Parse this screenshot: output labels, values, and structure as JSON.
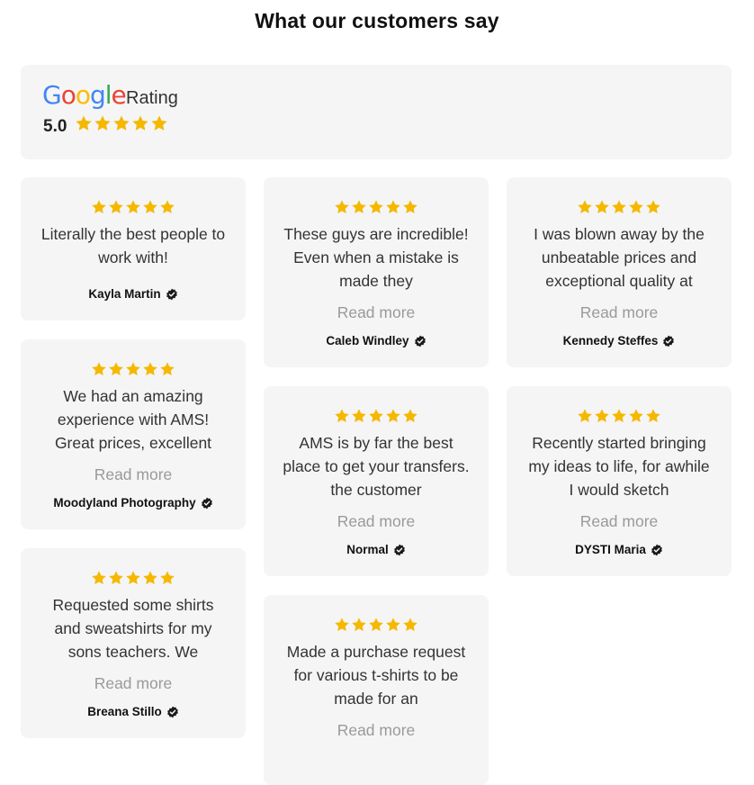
{
  "heading": "What our customers say",
  "summary": {
    "brand_letters": [
      {
        "ch": "G",
        "color": "#4285F4"
      },
      {
        "ch": "o",
        "color": "#EA4335"
      },
      {
        "ch": "o",
        "color": "#FBBC05"
      },
      {
        "ch": "g",
        "color": "#4285F4"
      },
      {
        "ch": "l",
        "color": "#34A853"
      },
      {
        "ch": "e",
        "color": "#EA4335"
      }
    ],
    "rating_label": "Rating",
    "score": "5.0",
    "stars": 5
  },
  "colors": {
    "star": "#F5B800",
    "card_bg": "#f5f5f5",
    "read_more": "#9a9a9a"
  },
  "read_more_label": "Read more",
  "reviews": [
    {
      "id": 1,
      "stars": 5,
      "text": "Literally the best people to work with!",
      "author": "Kayla Martin",
      "read_more": false
    },
    {
      "id": 2,
      "stars": 5,
      "text": "These guys are incredible! Even when a mistake is made they",
      "author": "Caleb Windley",
      "read_more": true
    },
    {
      "id": 3,
      "stars": 5,
      "text": "I was blown away by the unbeatable prices and exceptional quality at",
      "author": "Kennedy Steffes",
      "read_more": true
    },
    {
      "id": 4,
      "stars": 5,
      "text": "We had an amazing experience with AMS! Great prices, excellent",
      "author": "Moodyland Photography",
      "read_more": true
    },
    {
      "id": 5,
      "stars": 5,
      "text": "AMS is by far the best place to get your transfers. the customer",
      "author": "Normal",
      "read_more": true
    },
    {
      "id": 6,
      "stars": 5,
      "text": "Recently started bringing my ideas to life, for awhile I would sketch",
      "author": "DYSTI Maria",
      "read_more": true
    },
    {
      "id": 7,
      "stars": 5,
      "text": "Requested some shirts and sweatshirts for my sons teachers. We",
      "author": "Breana Stillo",
      "read_more": true
    },
    {
      "id": 8,
      "stars": 5,
      "text": "Made a purchase request for various t-shirts to be made for an",
      "author": "",
      "read_more": true
    }
  ]
}
